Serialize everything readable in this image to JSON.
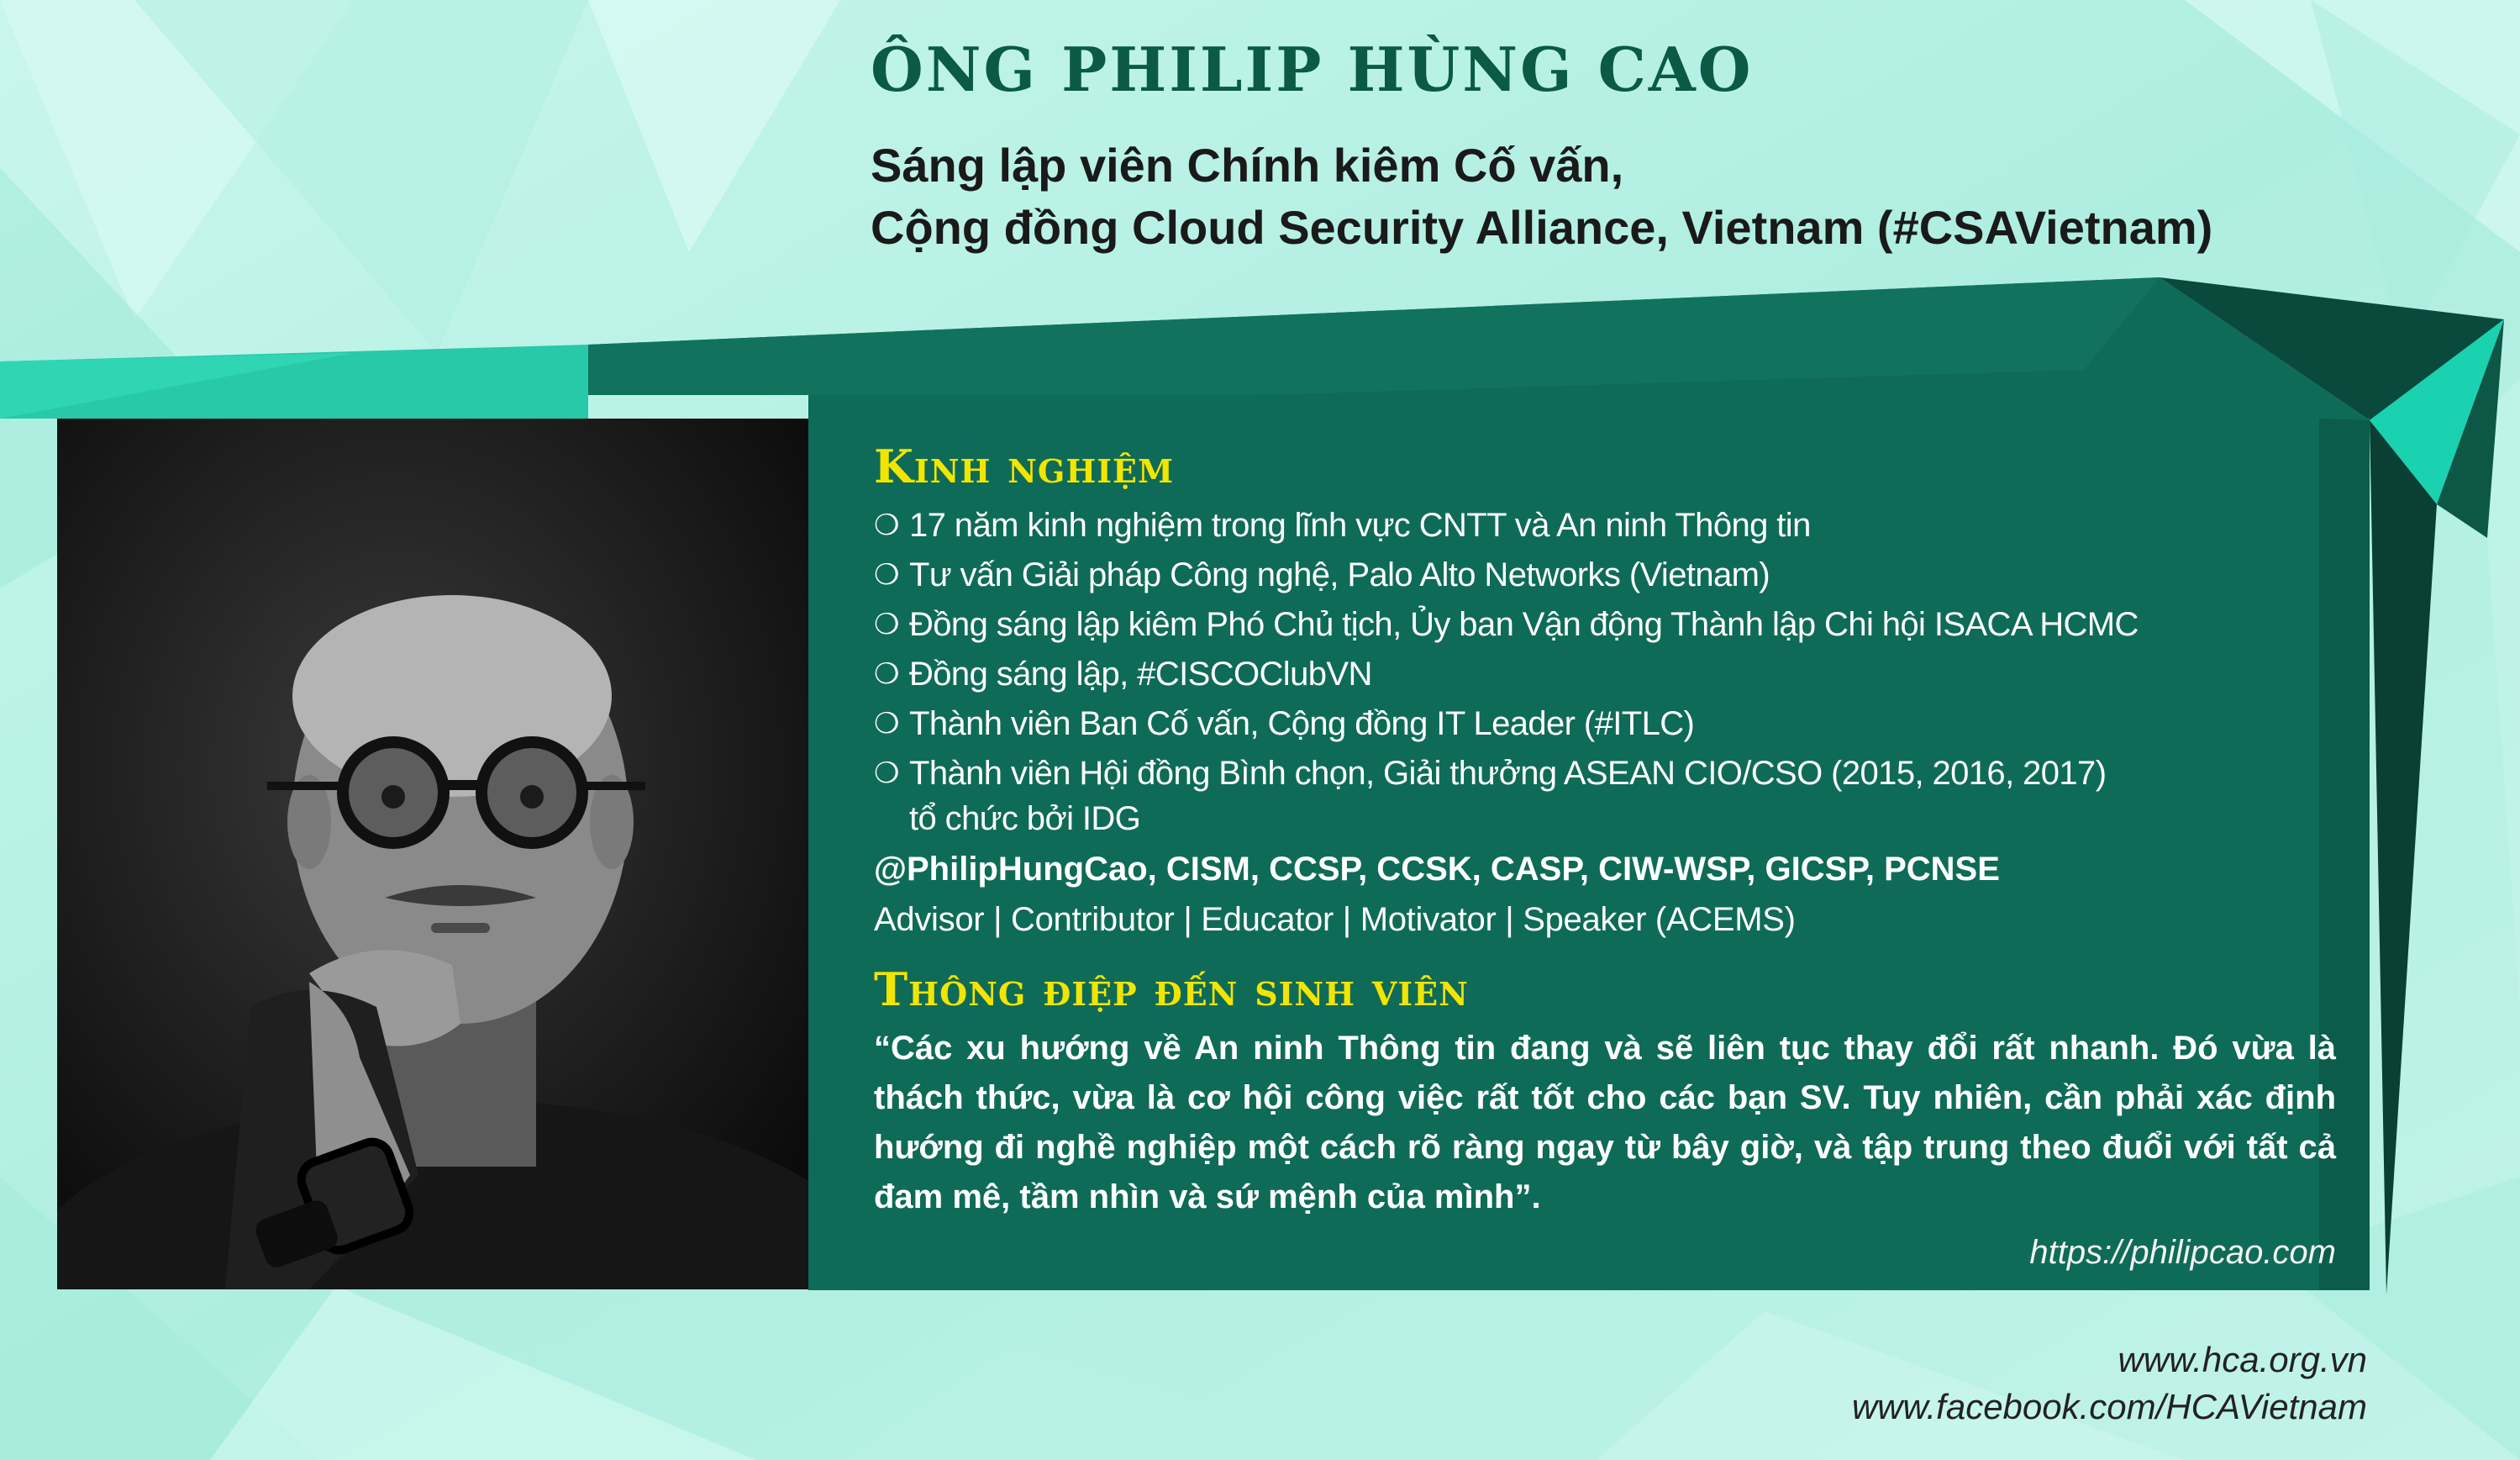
{
  "header": {
    "name": "ÔNG PHILIP HÙNG CAO",
    "subtitle_line1": "Sáng lập viên Chính kiêm Cố vấn,",
    "subtitle_line2": "Cộng đồng Cloud Security Alliance, Vietnam (#CSAVietnam)"
  },
  "experience": {
    "heading": "Kinh nghiệm",
    "bullet_glyph": "❍",
    "items": [
      "17 năm kinh nghiệm trong lĩnh vực CNTT và An ninh Thông tin",
      "Tư vấn Giải pháp Công nghệ, Palo Alto Networks (Vietnam)",
      "Đồng sáng lập kiêm Phó Chủ tịch, Ủy ban Vận động Thành lập Chi hội ISACA HCMC",
      "Đồng sáng lập, #CISCOClubVN",
      "Thành viên Ban Cố vấn, Cộng đồng IT Leader (#ITLC)",
      "Thành viên Hội đồng Bình chọn, Giải thưởng ASEAN CIO/CSO (2015, 2016, 2017)"
    ],
    "item6_continuation": "tổ chức bởi IDG",
    "handle": "@PhilipHungCao, CISM, CCSP, CCSK, CASP, CIW-WSP, GICSP, PCNSE",
    "roles": "Advisor | Contributor | Educator | Motivator | Speaker (ACEMS)"
  },
  "message": {
    "heading": "Thông điệp đến sinh viên",
    "quote": "“Các xu hướng về An ninh Thông tin đang và sẽ liên tục thay đổi rất nhanh. Đó vừa là thách thức, vừa là cơ hội công việc rất tốt cho các bạn SV. Tuy nhiên, cần phải xác định hướng đi nghề nghiệp một cách rõ ràng ngay từ bây giờ, và tập trung theo đuổi với tất cả đam mê, tầm nhìn và sứ mệnh của mình”.",
    "website": "https://philipcao.com"
  },
  "footer": {
    "site": "www.hca.org.vn",
    "facebook": "www.facebook.com/HCAVietnam"
  },
  "colors": {
    "background": "#bdf1e6",
    "panel": "#0e6b57",
    "panel_dark": "#0a4a3d",
    "accent": "#1ad1b0",
    "title_green": "#0a5a44",
    "heading_yellow": "#f2e500"
  },
  "photo": {
    "description_icon": "portrait-photo"
  }
}
